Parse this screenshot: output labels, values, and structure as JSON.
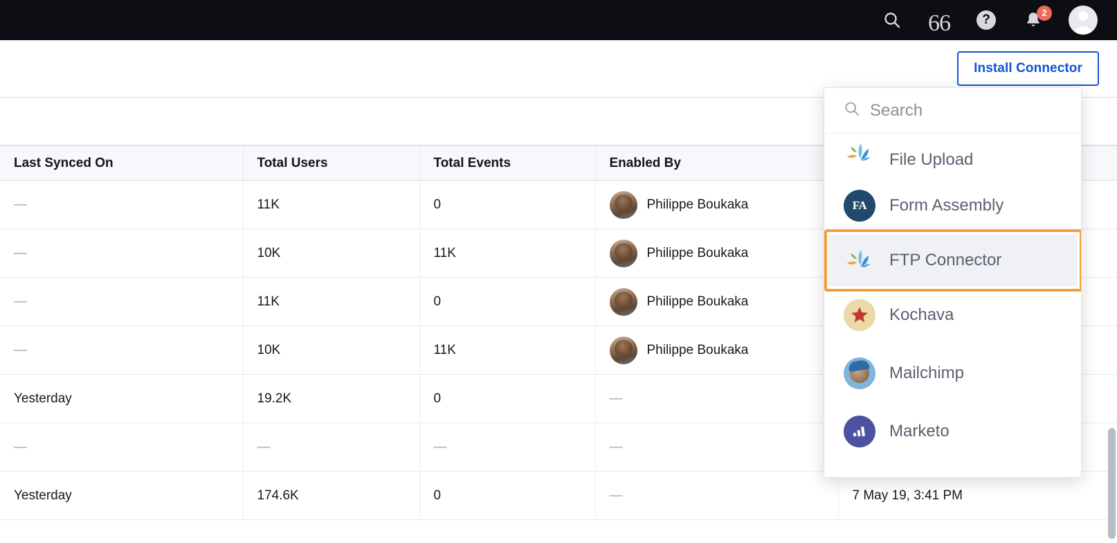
{
  "topbar": {
    "icons": [
      {
        "name": "search-icon",
        "label": "Search"
      },
      {
        "name": "quotes-icon",
        "label": "66"
      },
      {
        "name": "help-icon",
        "label": "?"
      },
      {
        "name": "notifications-bell-icon",
        "label": "Notifications"
      }
    ],
    "notification_count": "2",
    "avatar_label": "User account"
  },
  "actionbar": {
    "install_connector_label": "Install Connector",
    "accent_color": "#1151d3"
  },
  "table": {
    "columns": [
      "Last Synced On",
      "Total Users",
      "Total Events",
      "Enabled By",
      ""
    ],
    "rows": [
      {
        "last_synced_on": "—",
        "total_users": "11K",
        "total_events": "0",
        "enabled_by": "Philippe Boukaka",
        "has_avatar": true,
        "extra": ""
      },
      {
        "last_synced_on": "—",
        "total_users": "10K",
        "total_events": "11K",
        "enabled_by": "Philippe Boukaka",
        "has_avatar": true,
        "extra": ""
      },
      {
        "last_synced_on": "—",
        "total_users": "11K",
        "total_events": "0",
        "enabled_by": "Philippe Boukaka",
        "has_avatar": true,
        "extra": ""
      },
      {
        "last_synced_on": "—",
        "total_users": "10K",
        "total_events": "11K",
        "enabled_by": "Philippe Boukaka",
        "has_avatar": true,
        "extra": ""
      },
      {
        "last_synced_on": "Yesterday",
        "total_users": "19.2K",
        "total_events": "0",
        "enabled_by": "—",
        "has_avatar": false,
        "extra": ""
      },
      {
        "last_synced_on": "—",
        "total_users": "—",
        "total_events": "—",
        "enabled_by": "—",
        "has_avatar": false,
        "extra": ""
      },
      {
        "last_synced_on": "Yesterday",
        "total_users": "174.6K",
        "total_events": "0",
        "enabled_by": "—",
        "has_avatar": false,
        "extra": "7 May 19, 3:41 PM"
      }
    ]
  },
  "dropdown": {
    "search_placeholder": "Search",
    "search_value": "",
    "selected_item": "FTP Connector",
    "highlight_color": "#f0a03c",
    "items": [
      {
        "label": "File Upload",
        "icon": "splash-icon",
        "selected": false,
        "clipped": true
      },
      {
        "label": "Form Assembly",
        "icon": "form-assembly-icon",
        "selected": false,
        "clipped": false
      },
      {
        "label": "FTP Connector",
        "icon": "splash-icon",
        "selected": true,
        "clipped": false
      },
      {
        "label": "Kochava",
        "icon": "kochava-star-icon",
        "selected": false,
        "clipped": false
      },
      {
        "label": "Mailchimp",
        "icon": "mailchimp-icon",
        "selected": false,
        "clipped": false
      },
      {
        "label": "Marketo",
        "icon": "marketo-icon",
        "selected": false,
        "clipped": false
      }
    ]
  }
}
